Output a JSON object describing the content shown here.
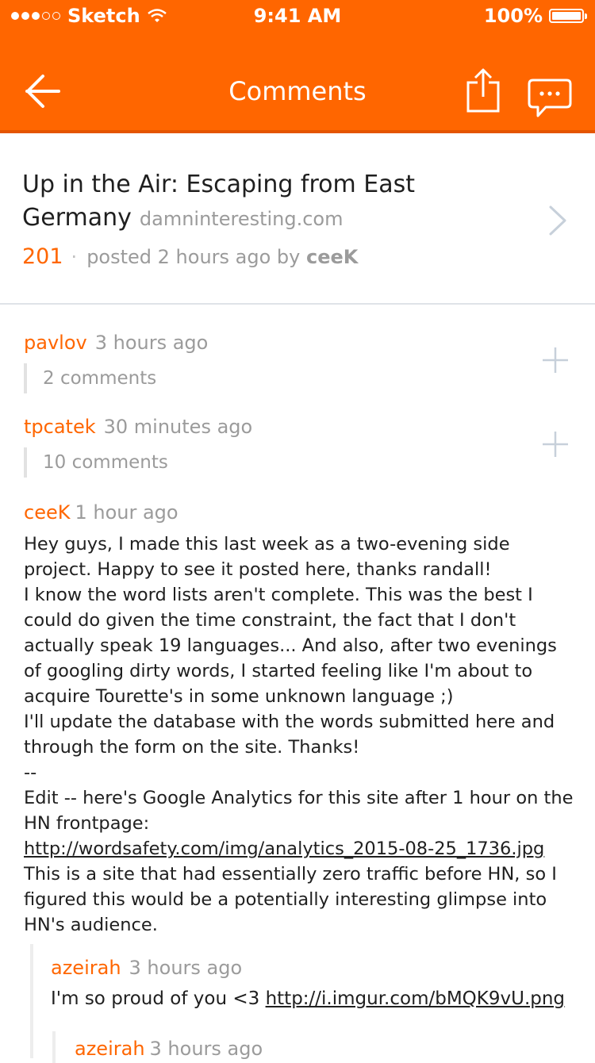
{
  "status_bar": {
    "carrier": "Sketch",
    "time": "9:41 AM",
    "battery": "100%"
  },
  "nav": {
    "title": "Comments",
    "back_icon": "back-arrow-icon",
    "share_icon": "share-icon",
    "chat_icon": "chat-bubble-icon"
  },
  "article": {
    "title": "Up in the Air: Escaping from East Germany",
    "domain": "damninteresting.com",
    "points": "201",
    "meta_separator": "·",
    "posted": "posted 2 hours ago by",
    "author": "ceeK"
  },
  "comments": [
    {
      "author": "pavlov",
      "time": "3 hours ago",
      "collapsed_count": "2 comments"
    },
    {
      "author": "tpcatek",
      "time": "30 minutes ago",
      "collapsed_count": "10 comments"
    },
    {
      "author": "ceeK",
      "time": "1 hour ago",
      "body_1": "Hey guys, I made this last week as a two-evening side project. Happy to see it posted here, thanks randall!\nI know the word lists aren't complete. This was the best I could do given the time constraint, the fact that I don't actually speak 19 languages... And also, after two evenings of googling dirty words, I started feeling like I'm about to acquire Tourette's in some unknown language ;)\nI'll update the database with the words submitted here and through the form on the site. Thanks!\n--\nEdit -- here's Google Analytics for this site after 1 hour on the HN frontpage:\n",
      "body_link": "http://wordsafety.com/img/analytics_2015-08-25_1736.jpg",
      "body_2": "\nThis is a site that had essentially zero traffic before HN, so I figured this would be a potentially interesting glimpse into HN's audience."
    }
  ],
  "replies": [
    {
      "author": "azeirah",
      "time": "3 hours ago",
      "body_text": "I'm so proud of you <3 ",
      "body_link": "http://i.imgur.com/bMQK9vU.png"
    },
    {
      "author": "azeirah",
      "time": "3 hours ago"
    }
  ]
}
